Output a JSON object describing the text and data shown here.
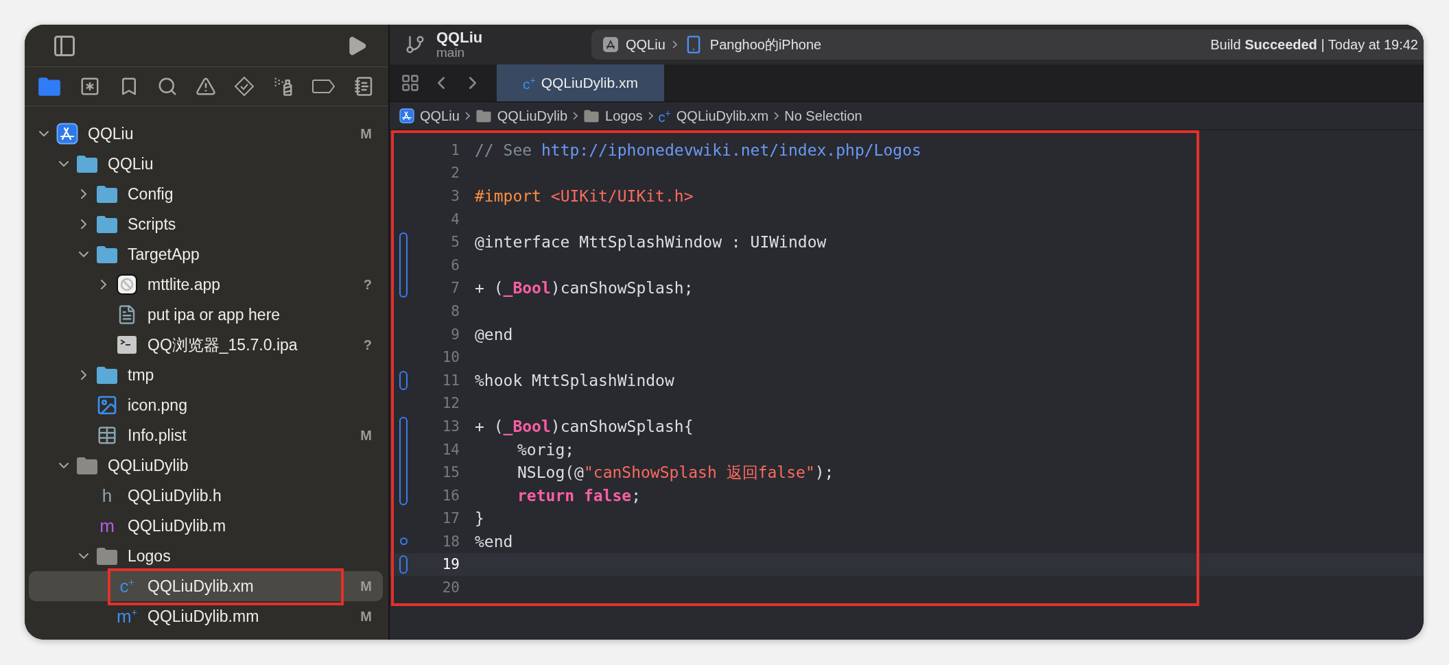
{
  "sidebar": {
    "navigator_tabs": [
      {
        "kind": "project",
        "selected": true
      },
      {
        "kind": "source-control",
        "selected": false
      },
      {
        "kind": "bookmarks",
        "selected": false
      },
      {
        "kind": "search",
        "selected": false
      },
      {
        "kind": "issues",
        "selected": false
      },
      {
        "kind": "tests",
        "selected": false
      },
      {
        "kind": "debug",
        "selected": false
      },
      {
        "kind": "breakpoints",
        "selected": false
      },
      {
        "kind": "reports",
        "selected": false
      }
    ],
    "tree": [
      {
        "name": "QQLiu",
        "kind": "project",
        "badge": "M",
        "expanded": true,
        "selected": false,
        "highlighted": false,
        "children": [
          {
            "name": "QQLiu",
            "kind": "folder",
            "expanded": true,
            "selected": false,
            "highlighted": false,
            "children": [
              {
                "name": "Config",
                "kind": "folder",
                "expanded": false,
                "selected": false,
                "highlighted": false
              },
              {
                "name": "Scripts",
                "kind": "folder",
                "expanded": false,
                "selected": false,
                "highlighted": false
              },
              {
                "name": "TargetApp",
                "kind": "folder",
                "expanded": true,
                "selected": false,
                "highlighted": false,
                "children": [
                  {
                    "name": "mttlite.app",
                    "kind": "app",
                    "badge": "?",
                    "expanded": false,
                    "selected": false,
                    "highlighted": false
                  },
                  {
                    "name": "put ipa or app here",
                    "kind": "text",
                    "selected": false,
                    "highlighted": false
                  },
                  {
                    "name": "QQ浏览器_15.7.0.ipa",
                    "kind": "terminal",
                    "badge": "?",
                    "selected": false,
                    "highlighted": false
                  }
                ]
              },
              {
                "name": "tmp",
                "kind": "folder",
                "expanded": false,
                "selected": false,
                "highlighted": false
              },
              {
                "name": "icon.png",
                "kind": "image",
                "selected": false,
                "highlighted": false
              },
              {
                "name": "Info.plist",
                "kind": "plist",
                "badge": "M",
                "selected": false,
                "highlighted": false
              }
            ]
          },
          {
            "name": "QQLiuDylib",
            "kind": "group",
            "expanded": true,
            "selected": false,
            "highlighted": false,
            "children": [
              {
                "name": "QQLiuDylib.h",
                "kind": "header",
                "glyph": "h",
                "selected": false,
                "highlighted": false
              },
              {
                "name": "QQLiuDylib.m",
                "kind": "objc",
                "glyph": "m",
                "selected": false,
                "highlighted": false
              },
              {
                "name": "Logos",
                "kind": "group",
                "expanded": true,
                "selected": false,
                "highlighted": false,
                "children": [
                  {
                    "name": "QQLiuDylib.xm",
                    "kind": "logos",
                    "glyph": "c$^{+}$",
                    "badge": "M",
                    "selected": true,
                    "highlighted": true
                  },
                  {
                    "name": "QQLiuDylib.mm",
                    "kind": "objcpp",
                    "glyph": "m$^{+}$",
                    "badge": "M",
                    "selected": false,
                    "highlighted": false
                  }
                ]
              }
            ]
          }
        ]
      }
    ]
  },
  "toolbar": {
    "project": "QQLiu",
    "branch": "main",
    "scheme": "QQLiu",
    "device": "Panghoo的iPhone",
    "status": "Build **Succeeded** | Today at 19:42"
  },
  "tabs": [
    {
      "glyph": "c$^{+}$",
      "label": "QQLiuDylib.xm",
      "selected": true
    }
  ],
  "jump_bar": [
    {
      "kind": "project",
      "label": "QQLiu"
    },
    {
      "kind": "group",
      "label": "QQLiuDylib"
    },
    {
      "kind": "group",
      "label": "Logos"
    },
    {
      "kind": "logos",
      "glyph": "c$^{+}$",
      "label": "QQLiuDylib.xm"
    },
    {
      "kind": "plain",
      "label": "No Selection"
    }
  ],
  "editor": {
    "highlighted": true,
    "lines": [
      {
        "number": "1",
        "kind": "plain",
        "current": false,
        "indented": false,
        "tokens": [
          {
            "kind": "comment",
            "text": "// See "
          },
          {
            "kind": "link",
            "text": "http://iphonedevwiki.net/index.php/Logos"
          }
        ]
      },
      {
        "number": "2",
        "kind": "plain",
        "current": false
      },
      {
        "number": "3",
        "kind": "plain",
        "current": false,
        "indented": false,
        "tokens": [
          {
            "kind": "preprocessor",
            "text": "#import "
          },
          {
            "kind": "string",
            "text": "<UIKit/UIKit.h>"
          }
        ]
      },
      {
        "number": "4",
        "kind": "plain",
        "current": false
      },
      {
        "number": "5",
        "kind": "changed",
        "current": false,
        "indented": false,
        "tokens": [
          {
            "kind": "plain",
            "text": "@interface MttSplashWindow : UIWindow"
          }
        ]
      },
      {
        "number": "6",
        "kind": "changed",
        "current": false
      },
      {
        "number": "7",
        "kind": "changed",
        "current": false,
        "indented": false,
        "tokens": [
          {
            "kind": "plain",
            "text": "+ ("
          },
          {
            "kind": "keyword",
            "text": "_Bool"
          },
          {
            "kind": "plain",
            "text": ")canShowSplash;"
          }
        ]
      },
      {
        "number": "8",
        "kind": "plain",
        "current": false
      },
      {
        "number": "9",
        "kind": "plain",
        "current": false,
        "indented": false,
        "tokens": [
          {
            "kind": "plain",
            "text": "@end"
          }
        ]
      },
      {
        "number": "10",
        "kind": "plain",
        "current": false
      },
      {
        "number": "11",
        "kind": "changed",
        "current": false,
        "indented": false,
        "tokens": [
          {
            "kind": "plain",
            "text": "%hook MttSplashWindow"
          }
        ]
      },
      {
        "number": "12",
        "kind": "plain",
        "current": false
      },
      {
        "number": "13",
        "kind": "changed",
        "current": false,
        "indented": false,
        "tokens": [
          {
            "kind": "plain",
            "text": "+ ("
          },
          {
            "kind": "keyword",
            "text": "_Bool"
          },
          {
            "kind": "plain",
            "text": ")canShowSplash{"
          }
        ]
      },
      {
        "number": "14",
        "kind": "changed",
        "current": false,
        "indented": true,
        "tokens": [
          {
            "kind": "plain",
            "text": "%orig;"
          }
        ]
      },
      {
        "number": "15",
        "kind": "changed",
        "current": false,
        "indented": true,
        "tokens": [
          {
            "kind": "plain",
            "text": "NSLog(@"
          },
          {
            "kind": "string",
            "text": "\"canShowSplash 返回false\""
          },
          {
            "kind": "plain",
            "text": ");"
          }
        ]
      },
      {
        "number": "16",
        "kind": "changed",
        "current": false,
        "indented": true,
        "tokens": [
          {
            "kind": "keyword",
            "text": "return false"
          },
          {
            "kind": "plain",
            "text": ";"
          }
        ]
      },
      {
        "number": "17",
        "kind": "plain",
        "current": false,
        "indented": false,
        "tokens": [
          {
            "kind": "plain",
            "text": "}"
          }
        ]
      },
      {
        "number": "18",
        "kind": "marked",
        "current": false,
        "indented": false,
        "tokens": [
          {
            "kind": "plain",
            "text": "%end"
          }
        ]
      },
      {
        "number": "19",
        "kind": "changed",
        "current": true
      },
      {
        "number": "20",
        "kind": "plain",
        "current": false
      }
    ]
  }
}
